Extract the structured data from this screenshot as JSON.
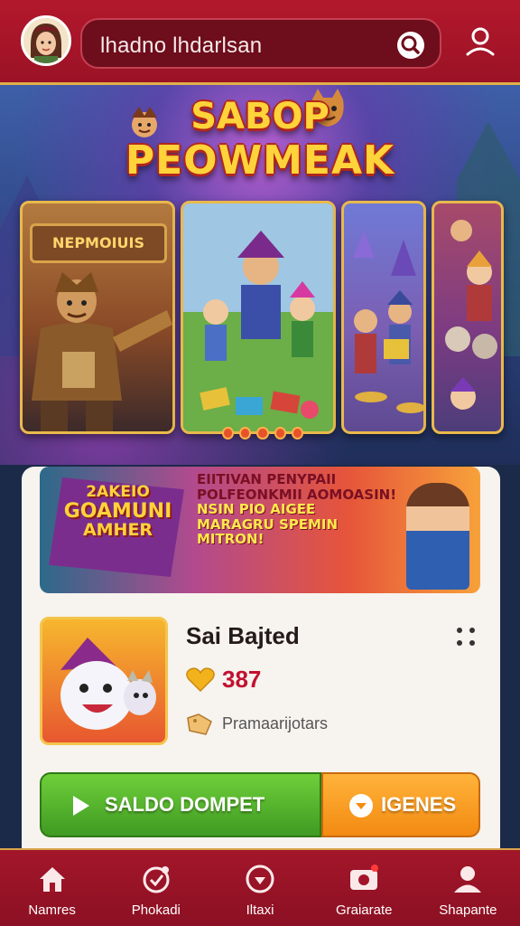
{
  "header": {
    "search_text": "lhadno lhdarlsan"
  },
  "hero": {
    "title_line1": "SABOP",
    "title_line2": "PEOWMEAK",
    "card1_sign": "NEPMOIUIS"
  },
  "promo": {
    "left_lines": [
      "2AKEIO",
      "GOAMUNI",
      "AMHER"
    ],
    "right_lines": [
      "EIITIVAN PENYPAII",
      "POLFEONKMII AOMOASIN!",
      "NSIN PIO AIGEE",
      "MARAGRU SPEMIN",
      "MITRON!"
    ]
  },
  "game": {
    "name": "Sai Bajted",
    "score": "387",
    "tag": "Pramaarijotars"
  },
  "actions": {
    "wallet_label": "SALDO DOMPET",
    "games_label": "IGENES"
  },
  "nav": [
    {
      "label": "Namres",
      "icon": "home-icon"
    },
    {
      "label": "Phokadi",
      "icon": "gift-icon"
    },
    {
      "label": "Iltaxi",
      "icon": "compass-icon"
    },
    {
      "label": "Graiarate",
      "icon": "camera-icon"
    },
    {
      "label": "Shapante",
      "icon": "user-icon"
    }
  ],
  "colors": {
    "brand_red": "#a3162a",
    "accent_gold": "#e9b94b",
    "wallet_green": "#4caf2a",
    "games_orange": "#f59a1e",
    "score_red": "#c01230"
  }
}
